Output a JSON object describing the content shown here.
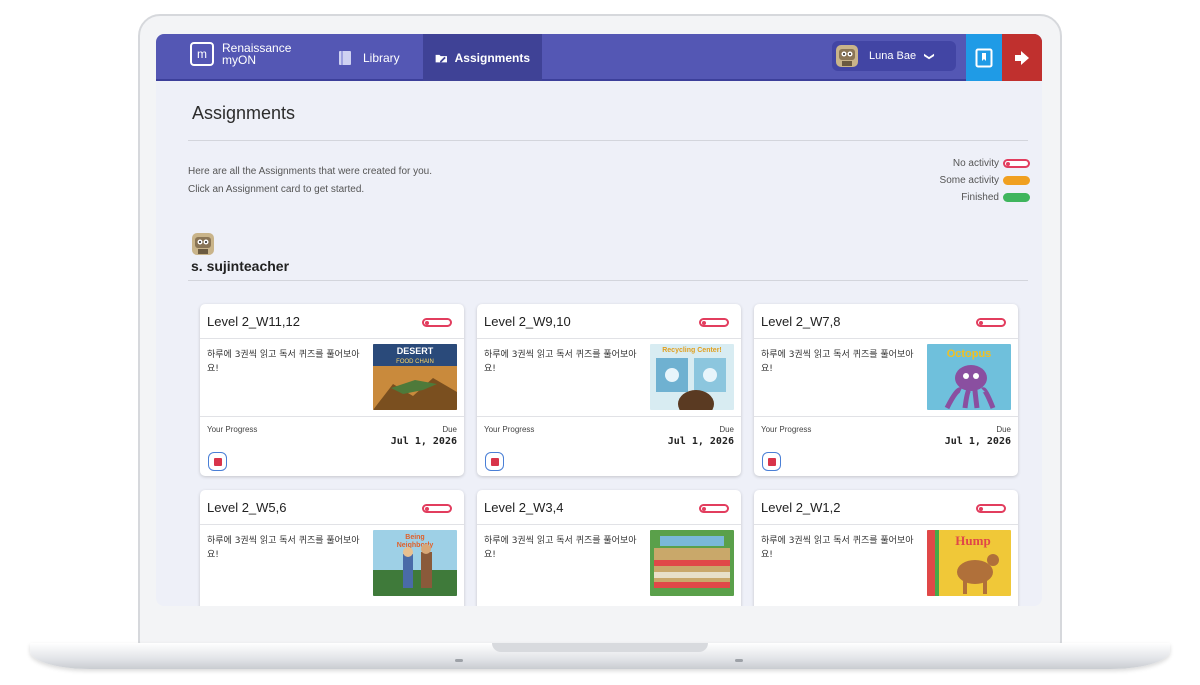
{
  "app": {
    "logo_line1": "Renaissance",
    "logo_line2": "myON",
    "logo_box": "m"
  },
  "nav": {
    "library": "Library",
    "assignments": "Assignments"
  },
  "user": {
    "name": "Luna Bae",
    "chevron": "❯"
  },
  "page": {
    "title": "Assignments",
    "intro_line1": "Here are all the Assignments that were created for you.",
    "intro_line2": "Click an Assignment card to get started."
  },
  "legend": {
    "no_activity": "No activity",
    "some_activity": "Some activity",
    "finished": "Finished"
  },
  "teacher": {
    "name": "s. sujinteacher"
  },
  "cards": [
    {
      "title": "Level 2_W11,12",
      "description": "하루에 3권씩 읽고 독서 퀴즈를 풀어보아요!",
      "progress_label": "Your Progress",
      "due_label": "Due",
      "due_date": "Jul 1, 2026",
      "cover_text": "DESERT FOOD CHAIN",
      "status": "No activity"
    },
    {
      "title": "Level 2_W9,10",
      "description": "하루에 3권씩 읽고 독서 퀴즈를 풀어보아요!",
      "progress_label": "Your Progress",
      "due_label": "Due",
      "due_date": "Jul 1, 2026",
      "cover_text": "Recycling Center!",
      "status": "No activity"
    },
    {
      "title": "Level 2_W7,8",
      "description": "하루에 3권씩 읽고 독서 퀴즈를 풀어보아요!",
      "progress_label": "Your Progress",
      "due_label": "Due",
      "due_date": "Jul 1, 2026",
      "cover_text": "Octopus",
      "status": "No activity"
    },
    {
      "title": "Level 2_W5,6",
      "description": "하루에 3권씩 읽고 독서 퀴즈를 풀어보아요!",
      "status": "No activity",
      "cover_text": "Being Neighborly"
    },
    {
      "title": "Level 2_W3,4",
      "description": "하루에 3권씩 읽고 독서 퀴즈를 풀어보아요!",
      "status": "No activity",
      "cover_text": ""
    },
    {
      "title": "Level 2_W1,2",
      "description": "하루에 3권씩 읽고 독서 퀴즈를 풀어보아요!",
      "status": "No activity",
      "cover_text": "Hump"
    }
  ],
  "colors": {
    "nav_bg": "#5457b4",
    "nav_active": "#3f4296",
    "blue_button": "#1f9be6",
    "red_button": "#c0302e",
    "no_activity": "#e23d5e",
    "some_activity": "#f0a020",
    "finished": "#3fb55d"
  },
  "icons": {
    "library": "book-icon",
    "assignments": "folder-pencil-icon",
    "blue_button": "bookmark-icon",
    "red_button": "logout-icon"
  }
}
